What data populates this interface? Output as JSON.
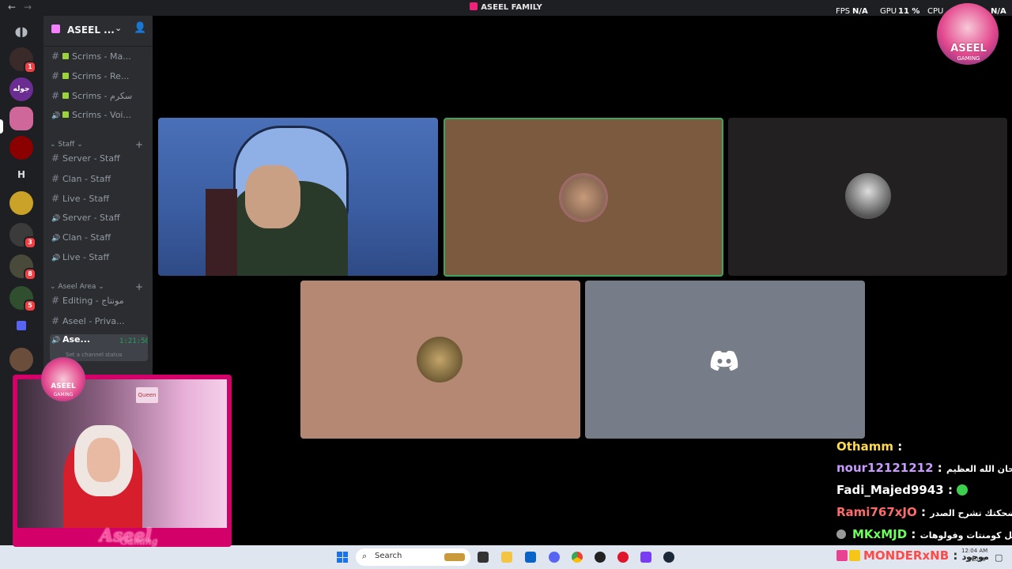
{
  "window": {
    "title": "ASEEL FAMILY",
    "back": "←",
    "forward": "→"
  },
  "stats": {
    "fps_label": "FPS",
    "fps_value": "N/A",
    "gpu_label": "GPU",
    "gpu_value": "11 %",
    "cpu_label": "CPU",
    "cpu_value": "N/A"
  },
  "servers": [
    {
      "text": "",
      "badge": "1"
    },
    {
      "text": "جوله",
      "badge": ""
    },
    {
      "text": "",
      "badge": ""
    },
    {
      "text": "",
      "badge": ""
    },
    {
      "text": "H",
      "badge": ""
    },
    {
      "text": "",
      "badge": ""
    },
    {
      "text": "",
      "badge": "3"
    },
    {
      "text": "",
      "badge": "8"
    },
    {
      "text": "",
      "badge": "5"
    }
  ],
  "sidebar": {
    "server_name": "ASEEL ...",
    "channels_top": [
      {
        "icon": "#",
        "label": "Scrims - Ma..."
      },
      {
        "icon": "#",
        "label": "Scrims - Re..."
      },
      {
        "icon": "#",
        "label": "Scrims - سكرم"
      },
      {
        "icon": "🔊",
        "label": "Scrims - Voi..."
      }
    ],
    "staff_category": "Staff",
    "staff_channels": [
      {
        "icon": "#",
        "label": "Server - Staff"
      },
      {
        "icon": "#",
        "label": "Clan - Staff"
      },
      {
        "icon": "#",
        "label": "Live - Staff"
      },
      {
        "icon": "🔊",
        "label": "Server - Staff"
      },
      {
        "icon": "🔊",
        "label": "Clan - Staff"
      },
      {
        "icon": "🔊",
        "label": "Live - Staff"
      }
    ],
    "area_category": "Aseel Area",
    "area_channels": [
      {
        "icon": "#",
        "label": "Editing - مونتاج"
      },
      {
        "icon": "#",
        "label": "Aseel - Priva..."
      }
    ],
    "active_channel": {
      "label": "Ase...",
      "timer": "1:21:50",
      "status": "Set a channel status"
    }
  },
  "chat": [
    {
      "name": "Othamm",
      "sep": " :",
      "msg": "",
      "color": "#ffd94f"
    },
    {
      "name": "nour12121212",
      "sep": " : ",
      "msg": "ده سبحان الله العظيم",
      "color": "#c79bff"
    },
    {
      "name": "Fadi_Majed9943",
      "sep": " : ",
      "msg": "",
      "color": "#ffffff"
    },
    {
      "name": "Rami767xJO",
      "sep": " : ",
      "msg": "ضحكتك تشرح الصدر",
      "color": "#ff6b6b"
    },
    {
      "name": "MKxMJD",
      "sep": " : ",
      "msg": "فاعل كومنتات وفولوهات",
      "color": "#6cff5a"
    },
    {
      "name": "MONDERxNB",
      "sep": " : ",
      "msg": "موجود",
      "color": "#ff4a4a"
    }
  ],
  "taskbar": {
    "search_placeholder": "Search",
    "time": "12:04 AM",
    "date": "1/2026"
  },
  "webcam": {
    "brand": "Aseel",
    "brand_sub": "Gaming",
    "logo_text": "ASEEL",
    "logo_sub": "GAMING"
  },
  "colors": {
    "tile_brown": "#7b5a3f",
    "tile_dark": "#222021",
    "tile_rose": "#b58874",
    "tile_gray": "#767c88",
    "tile_blue": "#3d5ea6",
    "speaking_border": "#3ba55d"
  }
}
